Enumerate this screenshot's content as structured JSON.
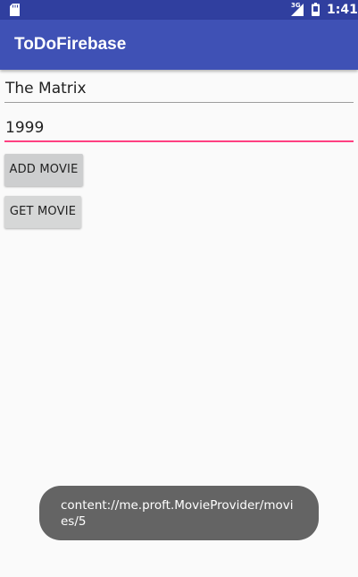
{
  "status_bar": {
    "network_label": "3G",
    "time": "1:41",
    "icons": [
      "sd-card-icon",
      "signal-icon",
      "battery-icon"
    ]
  },
  "app_bar": {
    "title": "ToDoFirebase"
  },
  "form": {
    "title_value": "The Matrix",
    "year_value": "1999"
  },
  "buttons": {
    "add_label": "ADD MOVIE",
    "get_label": "GET MOVIE"
  },
  "toast": {
    "message": "content://me.proft.MovieProvider/movies/5"
  },
  "colors": {
    "status_bar": "#303f9f",
    "app_bar": "#3f51b5",
    "accent": "#ff4081",
    "button": "#d6d7d7",
    "toast": "#646464"
  }
}
